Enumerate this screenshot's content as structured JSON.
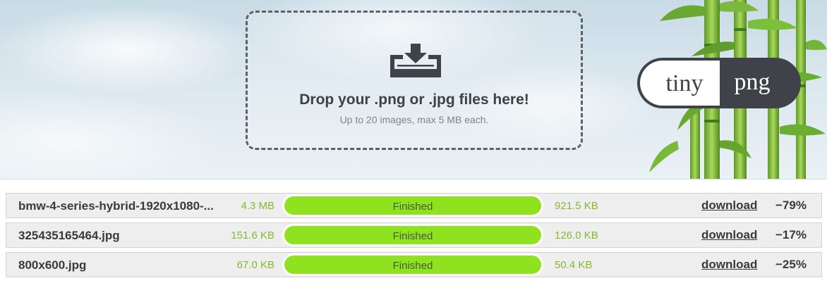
{
  "dropzone": {
    "title": "Drop your .png or .jpg files here!",
    "subtitle": "Up to 20 images, max 5 MB each.",
    "icon": "download-tray-icon"
  },
  "logo": {
    "left": "tiny",
    "right": "png"
  },
  "colors": {
    "progress": "#8ee31e",
    "size_text": "#85ba2f",
    "dark_text": "#3a3a3a",
    "logo_dark": "#3f4249"
  },
  "files": [
    {
      "name": "bmw-4-series-hybrid-1920x1080-...",
      "original_size": "4.3 MB",
      "status": "Finished",
      "progress": 1.0,
      "new_size": "921.5 KB",
      "action": "download",
      "savings": "−79%"
    },
    {
      "name": "325435165464.jpg",
      "original_size": "151.6 KB",
      "status": "Finished",
      "progress": 1.0,
      "new_size": "126.0 KB",
      "action": "download",
      "savings": "−17%"
    },
    {
      "name": "800x600.jpg",
      "original_size": "67.0 KB",
      "status": "Finished",
      "progress": 1.0,
      "new_size": "50.4 KB",
      "action": "download",
      "savings": "−25%"
    }
  ]
}
